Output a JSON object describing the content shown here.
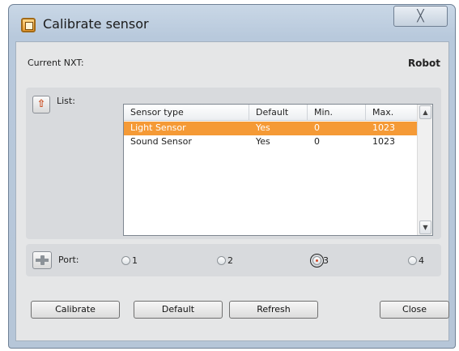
{
  "window": {
    "title": "Calibrate sensor",
    "close_glyph": "╳"
  },
  "nxt": {
    "label": "Current NXT:",
    "value": "Robot"
  },
  "list": {
    "label": "List:",
    "icon": "upload-icon",
    "columns": [
      "Sensor type",
      "Default",
      "Min.",
      "Max."
    ],
    "rows": [
      {
        "type": "Light Sensor",
        "default": "Yes",
        "min": "0",
        "max": "1023",
        "selected": true
      },
      {
        "type": "Sound Sensor",
        "default": "Yes",
        "min": "0",
        "max": "1023",
        "selected": false
      }
    ],
    "scroll_up": "▲",
    "scroll_down": "▼"
  },
  "port": {
    "label": "Port:",
    "icon": "port-plug-icon",
    "options": [
      "1",
      "2",
      "3",
      "4"
    ],
    "selected": "3"
  },
  "buttons": {
    "calibrate": "Calibrate",
    "default": "Default",
    "refresh": "Refresh",
    "close": "Close"
  },
  "colors": {
    "selection": "#f59a36",
    "client_bg": "#e5e6e7"
  }
}
